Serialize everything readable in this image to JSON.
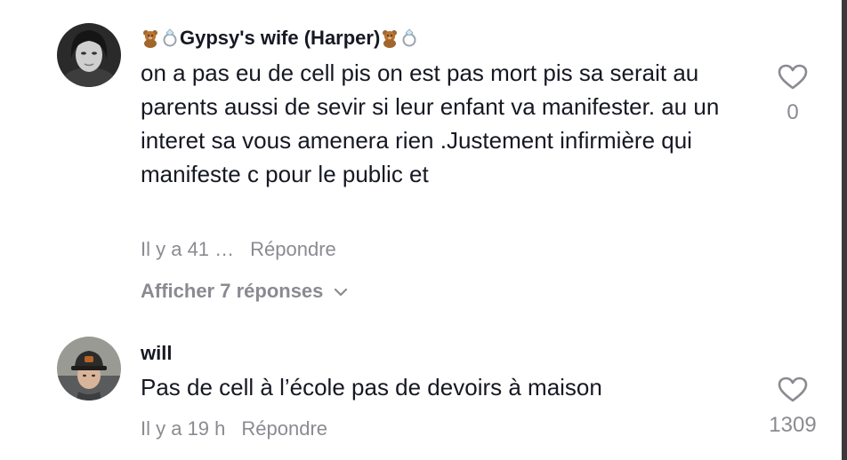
{
  "comments": [
    {
      "username": "Gypsy's wife (Harper)",
      "text": "on a pas eu de cell pis on est pas mort pis sa serait au parents aussi de sevir si leur enfant va manifester. au un interet sa vous amenera rien .Justement infirmière qui manifeste c pour le public et",
      "time": "Il y a 41 …",
      "reply_label": "Répondre",
      "show_replies_label": "Afficher 7 réponses",
      "likes": "0",
      "username_decor": [
        "teddy-bear-emoji",
        "ring-emoji"
      ]
    },
    {
      "username": "will",
      "text": "Pas de cell à l’école pas de devoirs à maison",
      "time": "Il y a 19 h",
      "reply_label": "Répondre",
      "likes": "1309"
    }
  ],
  "colors": {
    "text": "#161823",
    "muted": "#8a8b91",
    "background": "#ffffff"
  }
}
